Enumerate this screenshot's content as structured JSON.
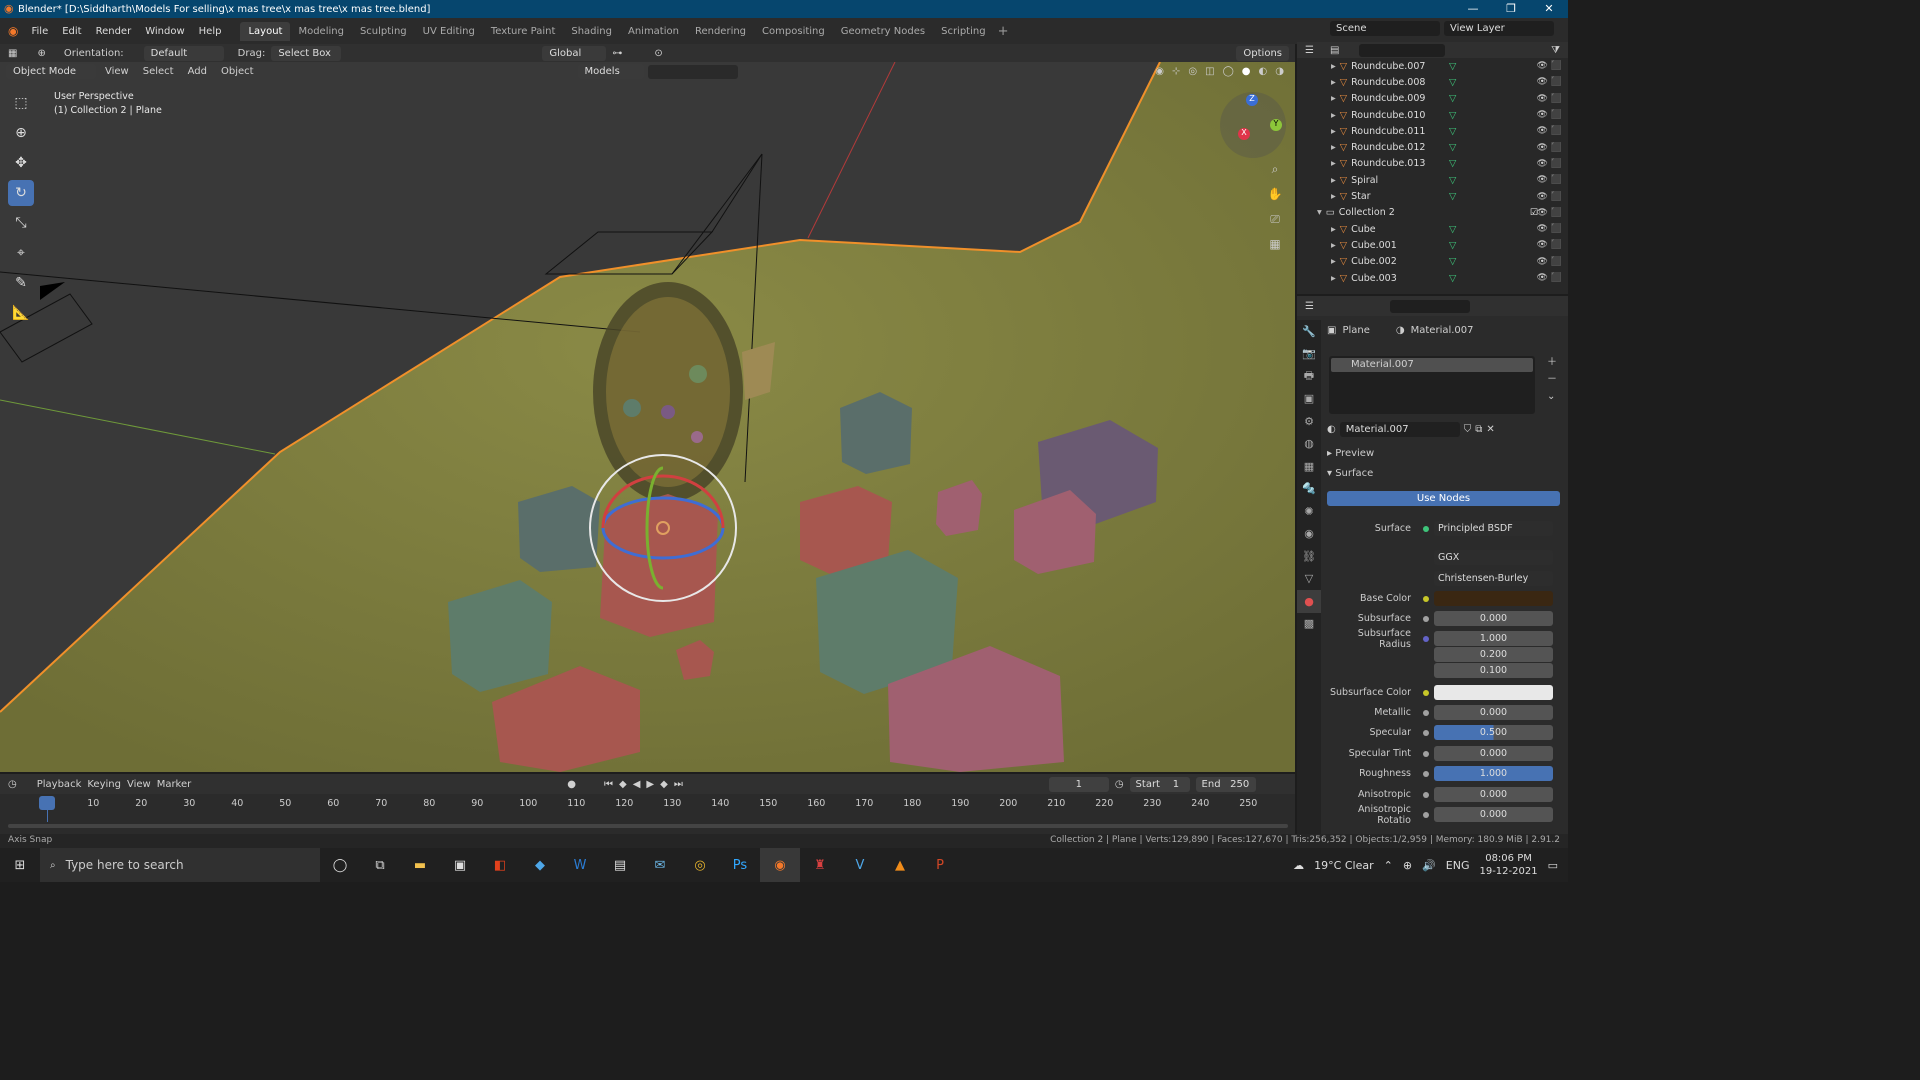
{
  "title": "Blender* [D:\\Siddharth\\Models For selling\\x mas tree\\x mas tree\\x mas tree.blend]",
  "menu": [
    "File",
    "Edit",
    "Render",
    "Window",
    "Help"
  ],
  "workspaces": [
    "Layout",
    "Modeling",
    "Sculpting",
    "UV Editing",
    "Texture Paint",
    "Shading",
    "Animation",
    "Rendering",
    "Compositing",
    "Geometry Nodes",
    "Scripting"
  ],
  "scene": "Scene",
  "view_layer": "View Layer",
  "tool_header": {
    "orientation_label": "Orientation:",
    "orientation": "Default",
    "drag_label": "Drag:",
    "drag": "Select Box",
    "transform": "Global",
    "options": "Options"
  },
  "viewport_header": {
    "mode": "Object Mode",
    "items": [
      "View",
      "Select",
      "Add",
      "Object"
    ],
    "models": "Models"
  },
  "viewport_info": {
    "line1": "User Perspective",
    "line2": "(1) Collection 2 | Plane"
  },
  "gizmo": {
    "x": "X",
    "y": "Y",
    "z": "Z"
  },
  "outliner": {
    "items": [
      {
        "name": "Roundcube.007"
      },
      {
        "name": "Roundcube.008"
      },
      {
        "name": "Roundcube.009"
      },
      {
        "name": "Roundcube.010"
      },
      {
        "name": "Roundcube.011"
      },
      {
        "name": "Roundcube.012"
      },
      {
        "name": "Roundcube.013"
      },
      {
        "name": "Spiral"
      },
      {
        "name": "Star"
      }
    ],
    "collection": "Collection 2",
    "items2": [
      {
        "name": "Cube"
      },
      {
        "name": "Cube.001"
      },
      {
        "name": "Cube.002"
      },
      {
        "name": "Cube.003"
      }
    ]
  },
  "properties": {
    "object": "Plane",
    "material": "Material.007",
    "slot": "Material.007",
    "datablock": "Material.007",
    "preview": "Preview",
    "surface_section": "Surface",
    "use_nodes": "Use Nodes",
    "surface_label": "Surface",
    "surface_value": "Principled BSDF",
    "distribution": "GGX",
    "subsurface_method": "Christensen-Burley",
    "rows": [
      {
        "label": "Base Color",
        "value": ""
      },
      {
        "label": "Subsurface",
        "value": "0.000"
      },
      {
        "label": "Subsurface Radius",
        "value": "1.000"
      },
      {
        "label": "",
        "value": "0.200"
      },
      {
        "label": "",
        "value": "0.100"
      },
      {
        "label": "Subsurface Color",
        "value": ""
      },
      {
        "label": "Metallic",
        "value": "0.000"
      },
      {
        "label": "Specular",
        "value": "0.500"
      },
      {
        "label": "Specular Tint",
        "value": "0.000"
      },
      {
        "label": "Roughness",
        "value": "1.000"
      },
      {
        "label": "Anisotropic",
        "value": "0.000"
      },
      {
        "label": "Anisotropic Rotatio",
        "value": "0.000"
      }
    ],
    "specular_fill": 0.5,
    "roughness_fill": 1.0
  },
  "timeline": {
    "menus": [
      "Playback",
      "Keying",
      "View",
      "Marker"
    ],
    "current": "1",
    "start_label": "Start",
    "start": "1",
    "end_label": "End",
    "end": "250",
    "ticks": [
      "1",
      "10",
      "20",
      "30",
      "40",
      "50",
      "60",
      "70",
      "80",
      "90",
      "100",
      "110",
      "120",
      "130",
      "140",
      "150",
      "160",
      "170",
      "180",
      "190",
      "200",
      "210",
      "220",
      "230",
      "240",
      "250"
    ]
  },
  "status": {
    "left": "Axis Snap",
    "right": "Collection 2 | Plane | Verts:129,890 | Faces:127,670 | Tris:256,352 | Objects:1/2,959 | Memory: 180.9 MiB | 2.91.2"
  },
  "taskbar": {
    "search": "Type here to search",
    "weather": "19°C Clear",
    "lang": "ENG",
    "time": "08:06 PM",
    "date": "19-12-2021"
  }
}
